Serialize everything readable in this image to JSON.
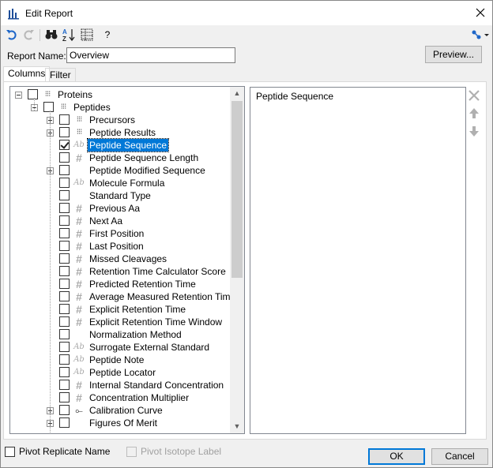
{
  "window": {
    "title": "Edit Report"
  },
  "toolbar": {
    "buttons": [
      "undo-icon",
      "redo-icon",
      "binoculars-icon",
      "sort-az-icon",
      "columns-icon",
      "help-icon"
    ],
    "help_label": "?"
  },
  "report": {
    "name_label": "Report Name:",
    "name_value": "Overview",
    "preview_label": "Preview..."
  },
  "tabs": [
    {
      "label": "Columns"
    },
    {
      "label": "Filter"
    }
  ],
  "tree": {
    "root": "Proteins",
    "child": "Peptides",
    "items": [
      {
        "label": "Precursors",
        "icon": "table",
        "expandable": true,
        "checked": false
      },
      {
        "label": "Peptide Results",
        "icon": "table",
        "expandable": true,
        "checked": false
      },
      {
        "label": "Peptide Sequence",
        "icon": "ab",
        "expandable": false,
        "checked": true,
        "selected": true
      },
      {
        "label": "Peptide Sequence Length",
        "icon": "hash",
        "expandable": false,
        "checked": false
      },
      {
        "label": "Peptide Modified Sequence",
        "icon": "none",
        "expandable": true,
        "checked": false
      },
      {
        "label": "Molecule Formula",
        "icon": "ab",
        "expandable": false,
        "checked": false
      },
      {
        "label": "Standard Type",
        "icon": "none",
        "expandable": false,
        "checked": false
      },
      {
        "label": "Previous Aa",
        "icon": "hash",
        "expandable": false,
        "checked": false
      },
      {
        "label": "Next Aa",
        "icon": "hash",
        "expandable": false,
        "checked": false
      },
      {
        "label": "First Position",
        "icon": "hash",
        "expandable": false,
        "checked": false
      },
      {
        "label": "Last Position",
        "icon": "hash",
        "expandable": false,
        "checked": false
      },
      {
        "label": "Missed Cleavages",
        "icon": "hash",
        "expandable": false,
        "checked": false
      },
      {
        "label": "Retention Time Calculator Score",
        "icon": "hash",
        "expandable": false,
        "checked": false
      },
      {
        "label": "Predicted Retention Time",
        "icon": "hash",
        "expandable": false,
        "checked": false
      },
      {
        "label": "Average Measured Retention Time",
        "icon": "hash",
        "expandable": false,
        "checked": false
      },
      {
        "label": "Explicit Retention Time",
        "icon": "hash",
        "expandable": false,
        "checked": false
      },
      {
        "label": "Explicit Retention Time Window",
        "icon": "hash",
        "expandable": false,
        "checked": false
      },
      {
        "label": "Normalization Method",
        "icon": "none",
        "expandable": false,
        "checked": false
      },
      {
        "label": "Surrogate External Standard",
        "icon": "ab",
        "expandable": false,
        "checked": false
      },
      {
        "label": "Peptide Note",
        "icon": "ab",
        "expandable": false,
        "checked": false
      },
      {
        "label": "Peptide Locator",
        "icon": "ab",
        "expandable": false,
        "checked": false
      },
      {
        "label": "Internal Standard Concentration",
        "icon": "hash",
        "expandable": false,
        "checked": false
      },
      {
        "label": "Concentration Multiplier",
        "icon": "hash",
        "expandable": false,
        "checked": false
      },
      {
        "label": "Calibration Curve",
        "icon": "link",
        "expandable": true,
        "checked": false
      },
      {
        "label": "Figures Of Merit",
        "icon": "none",
        "expandable": true,
        "checked": false
      }
    ]
  },
  "selected_columns": [
    "Peptide Sequence"
  ],
  "options": {
    "pivot_replicate_label": "Pivot Replicate Name",
    "pivot_isotope_label": "Pivot Isotope Label"
  },
  "buttons": {
    "ok_label": "OK",
    "cancel_label": "Cancel"
  },
  "colors": {
    "selection": "#0078d7",
    "default_button_border": "#0078d7"
  }
}
